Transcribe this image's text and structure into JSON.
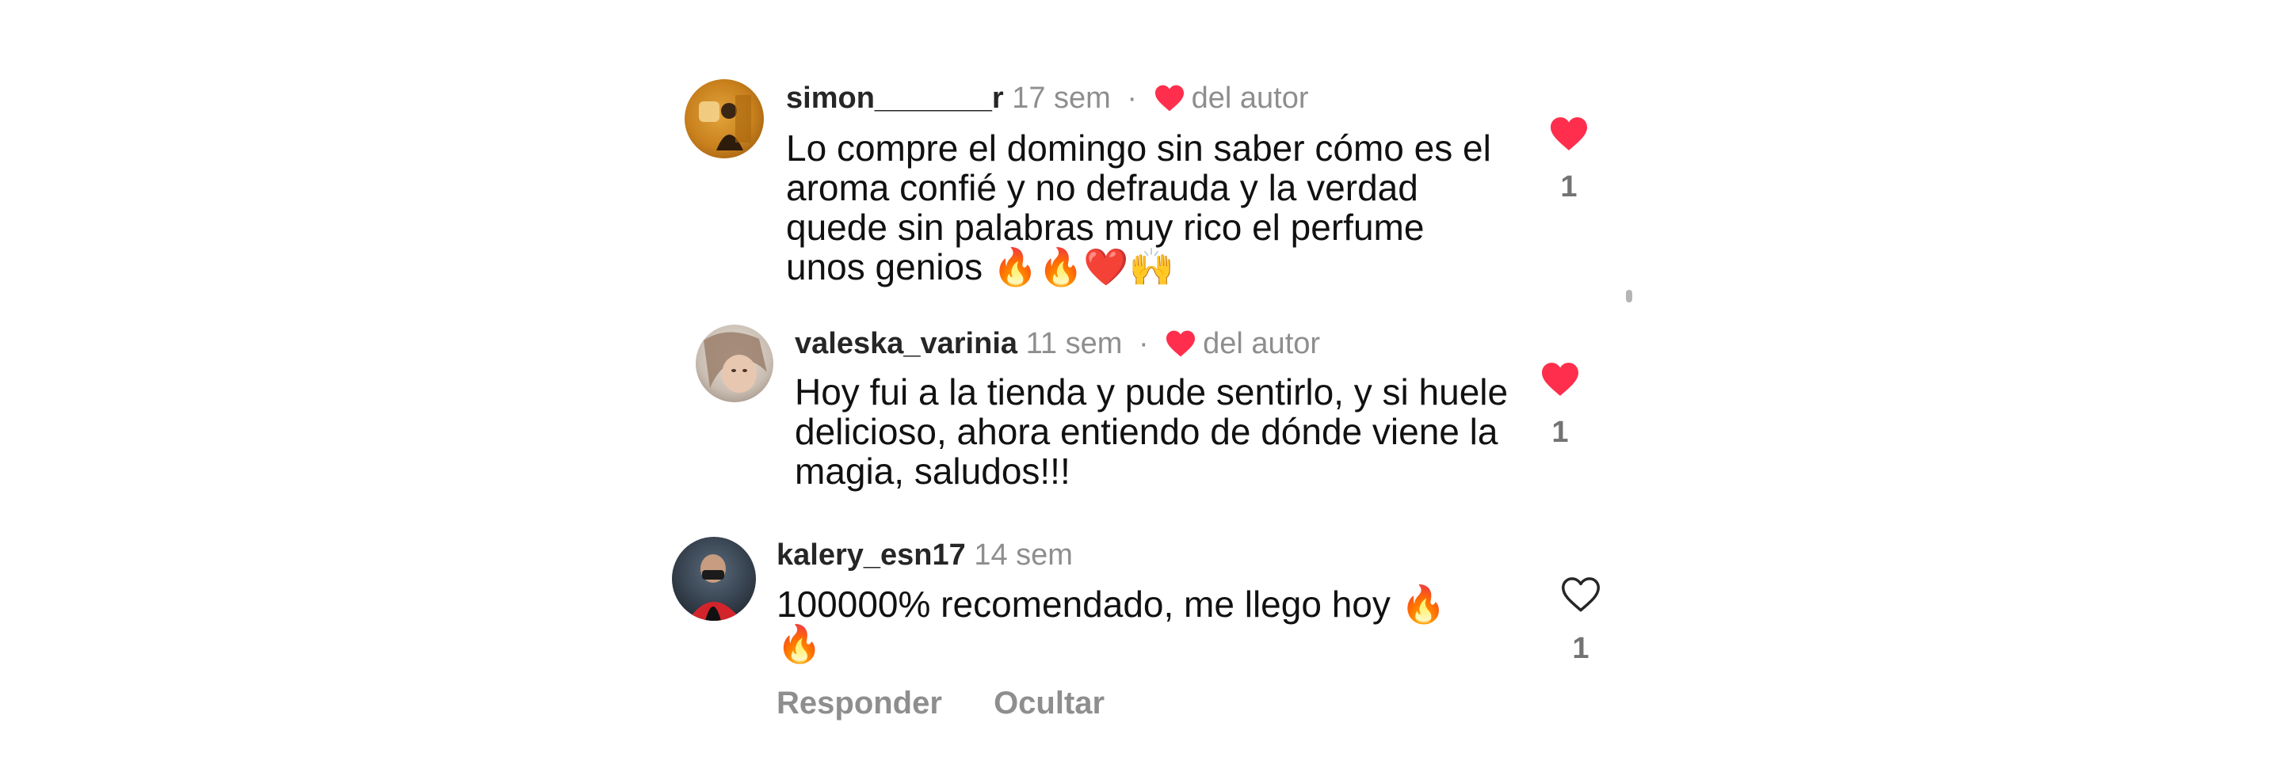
{
  "comments": [
    {
      "username": "simon_______r",
      "time": "17 sem",
      "author_liked": true,
      "author_liked_label": "del autor",
      "text": "Lo compre el domingo sin saber cómo es el\naroma confié y no defrauda y la verdad\nquede sin palabras muy rico el perfume\nunos genios 🔥🔥❤️🙌",
      "liked": true,
      "like_count": "1"
    },
    {
      "username": "valeska_varinia",
      "time": "11 sem",
      "author_liked": true,
      "author_liked_label": "del autor",
      "text": "Hoy fui a la tienda y pude sentirlo, y si huele\ndelicioso, ahora entiendo de dónde viene la\nmagia, saludos!!!",
      "liked": true,
      "like_count": "1"
    },
    {
      "username": "kalery_esn17",
      "time": "14 sem",
      "author_liked": false,
      "text": "100000% recomendado, me llego hoy 🔥\n🔥",
      "liked": false,
      "like_count": "1"
    }
  ],
  "actions": {
    "reply": "Responder",
    "hide": "Ocultar"
  },
  "colors": {
    "heart_red": "#ff2e4d",
    "muted_gray": "#8e8e8e",
    "username": "#262626"
  }
}
